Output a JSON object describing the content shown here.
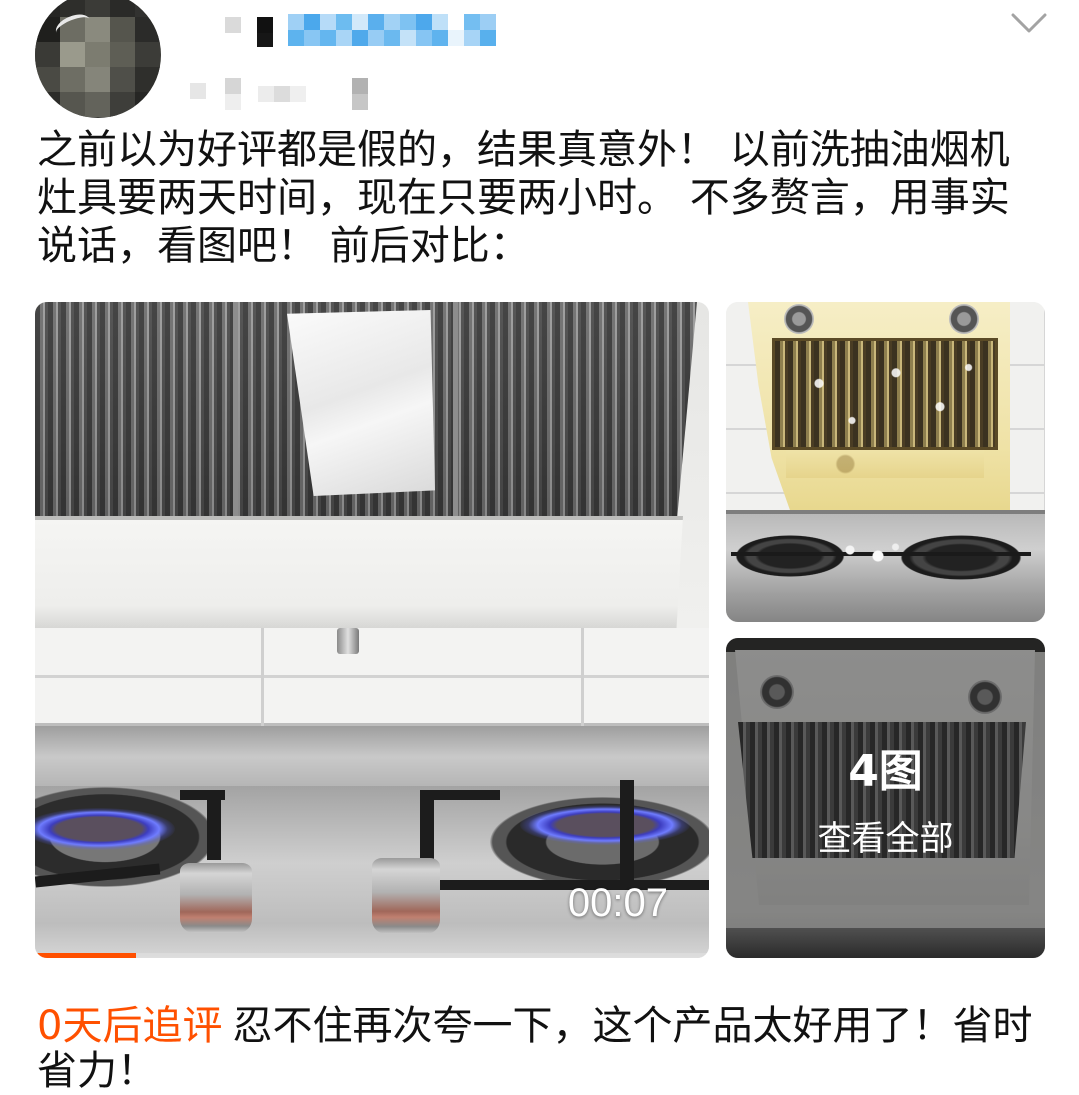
{
  "header": {
    "expand_icon": "chevron-down-icon"
  },
  "review": {
    "text": "之前以为好评都是假的，结果真意外！ 以前洗抽油烟机灶具要两天时间，现在只要两小时。 不多赘言，用事实说话，看图吧！ 前后对比："
  },
  "media": {
    "video": {
      "duration": "00:07",
      "progress": 0.15
    },
    "more_photos": {
      "count_label": "4图",
      "view_all_label": "查看全部"
    }
  },
  "follow_up": {
    "label": "0天后追评",
    "text": "忍不住再次夸一下，这个产品太好用了！省时省力！"
  },
  "colors": {
    "accent": "#ff5000",
    "text": "#111111"
  }
}
